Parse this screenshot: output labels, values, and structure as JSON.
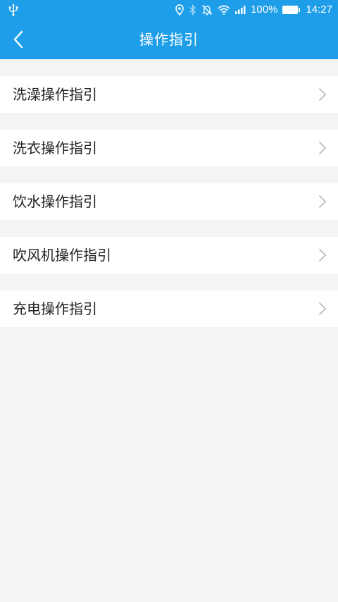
{
  "status_bar": {
    "battery_percent": "100%",
    "time": "14:27",
    "icons": [
      "usb-icon",
      "location-icon",
      "bluetooth-icon",
      "mute-icon",
      "wifi-icon",
      "signal-icon",
      "battery-icon"
    ]
  },
  "app_bar": {
    "title": "操作指引",
    "back_icon": "back-arrow-icon"
  },
  "list": {
    "items": [
      {
        "label": "洗澡操作指引",
        "icon": "chevron-right-icon"
      },
      {
        "label": "洗衣操作指引",
        "icon": "chevron-right-icon"
      },
      {
        "label": "饮水操作指引",
        "icon": "chevron-right-icon"
      },
      {
        "label": "吹风机操作指引",
        "icon": "chevron-right-icon"
      },
      {
        "label": "充电操作指引",
        "icon": "chevron-right-icon"
      }
    ]
  },
  "colors": {
    "primary": "#1e9ee9",
    "background": "#f4f4f4",
    "item_background": "#ffffff",
    "text": "#222222",
    "chevron": "#b8b8b8"
  }
}
